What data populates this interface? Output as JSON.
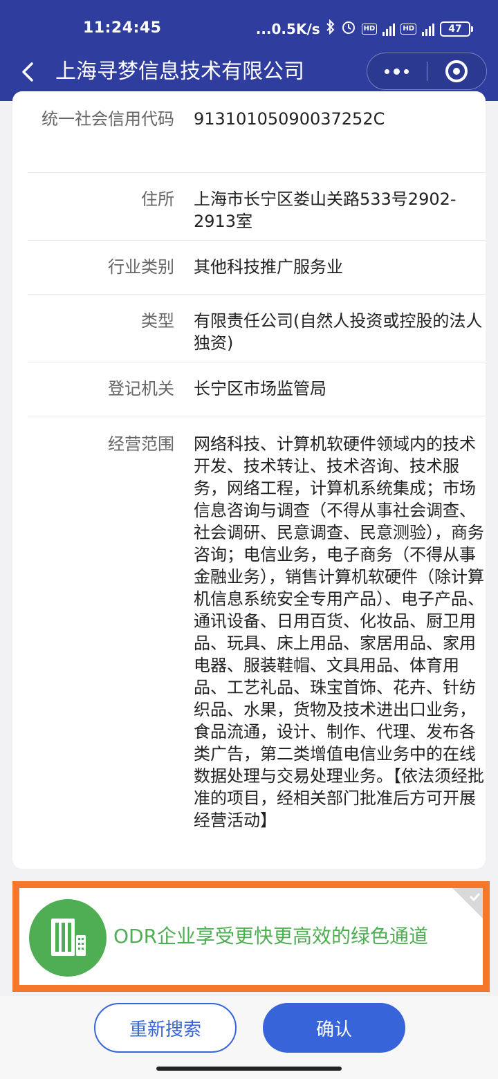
{
  "status_bar": {
    "time": "11:24:45",
    "network_speed": "...0.5K/s",
    "hd_badge": "HD",
    "network_type": "4G",
    "battery": "47"
  },
  "header": {
    "title": "上海寻梦信息技术有限公司",
    "icons": [
      "back-icon",
      "more-icon",
      "close-icon"
    ]
  },
  "info_rows": [
    {
      "label": "统一社会信用代码",
      "value": "91310105090037252C"
    },
    {
      "label": "住所",
      "value": "上海市长宁区娄山关路533号2902-2913室"
    },
    {
      "label": "行业类别",
      "value": "其他科技推广服务业"
    },
    {
      "label": "类型",
      "value": "有限责任公司(自然人投资或控股的法人独资)"
    },
    {
      "label": "登记机关",
      "value": "长宁区市场监管局"
    },
    {
      "label": "经营范围",
      "value": "网络科技、计算机软硬件领域内的技术开发、技术转让、技术咨询、技术服务，网络工程，计算机系统集成；市场信息咨询与调查（不得从事社会调查、社会调研、民意调查、民意测验），商务咨询；电信业务，电子商务（不得从事金融业务），销售计算机软硬件（除计算机信息系统安全专用产品）、电子产品、通讯设备、日用百货、化妆品、厨卫用品、玩具、床上用品、家居用品、家用电器、服装鞋帽、文具用品、体育用品、工艺礼品、珠宝首饰、花卉、针纺织品、水果，货物及技术进出口业务，食品流通，设计、制作、代理、发布各类广告，第二类增值电信业务中的在线数据处理与交易处理业务。【依法须经批准的项目，经相关部门批准后方可开展经营活动】"
    }
  ],
  "odr_banner": {
    "text": "ODR企业享受更快更高效的绿色通道",
    "accent_color": "#4fae53",
    "border_color": "#f4772a"
  },
  "buttons": {
    "research": "重新搜索",
    "confirm": "确认"
  },
  "colors": {
    "header_bg": "#2f3e9e",
    "primary": "#3764d8"
  }
}
